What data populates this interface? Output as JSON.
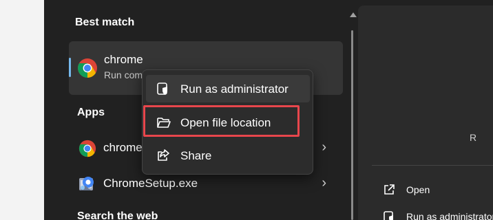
{
  "colors": {
    "panel_bg": "#212121",
    "card_bg": "#353535",
    "menu_bg": "#2c2c2c",
    "accent": "#76b9ed",
    "highlight": "#e8464c"
  },
  "sections": {
    "best_match": "Best match",
    "apps": "Apps",
    "search_web": "Search the web"
  },
  "best_match": {
    "name": "chrome",
    "subtitle": "Run command",
    "icon": "chrome-logo-icon"
  },
  "apps": [
    {
      "name": "chrome",
      "icon": "chrome-logo-icon",
      "chevron": "›"
    },
    {
      "name": "ChromeSetup.exe",
      "icon": "setup-installer-icon",
      "chevron": "›"
    }
  ],
  "context_menu": {
    "items": [
      {
        "label": "Run as administrator",
        "icon": "shield-admin-icon"
      },
      {
        "label": "Open file location",
        "icon": "folder-open-icon"
      },
      {
        "label": "Share",
        "icon": "share-icon"
      }
    ]
  },
  "preview": {
    "partial_text": "R",
    "actions": [
      {
        "label": "Open",
        "icon": "open-external-icon"
      },
      {
        "label": "Run as administrator",
        "icon": "shield-admin-icon"
      }
    ]
  }
}
